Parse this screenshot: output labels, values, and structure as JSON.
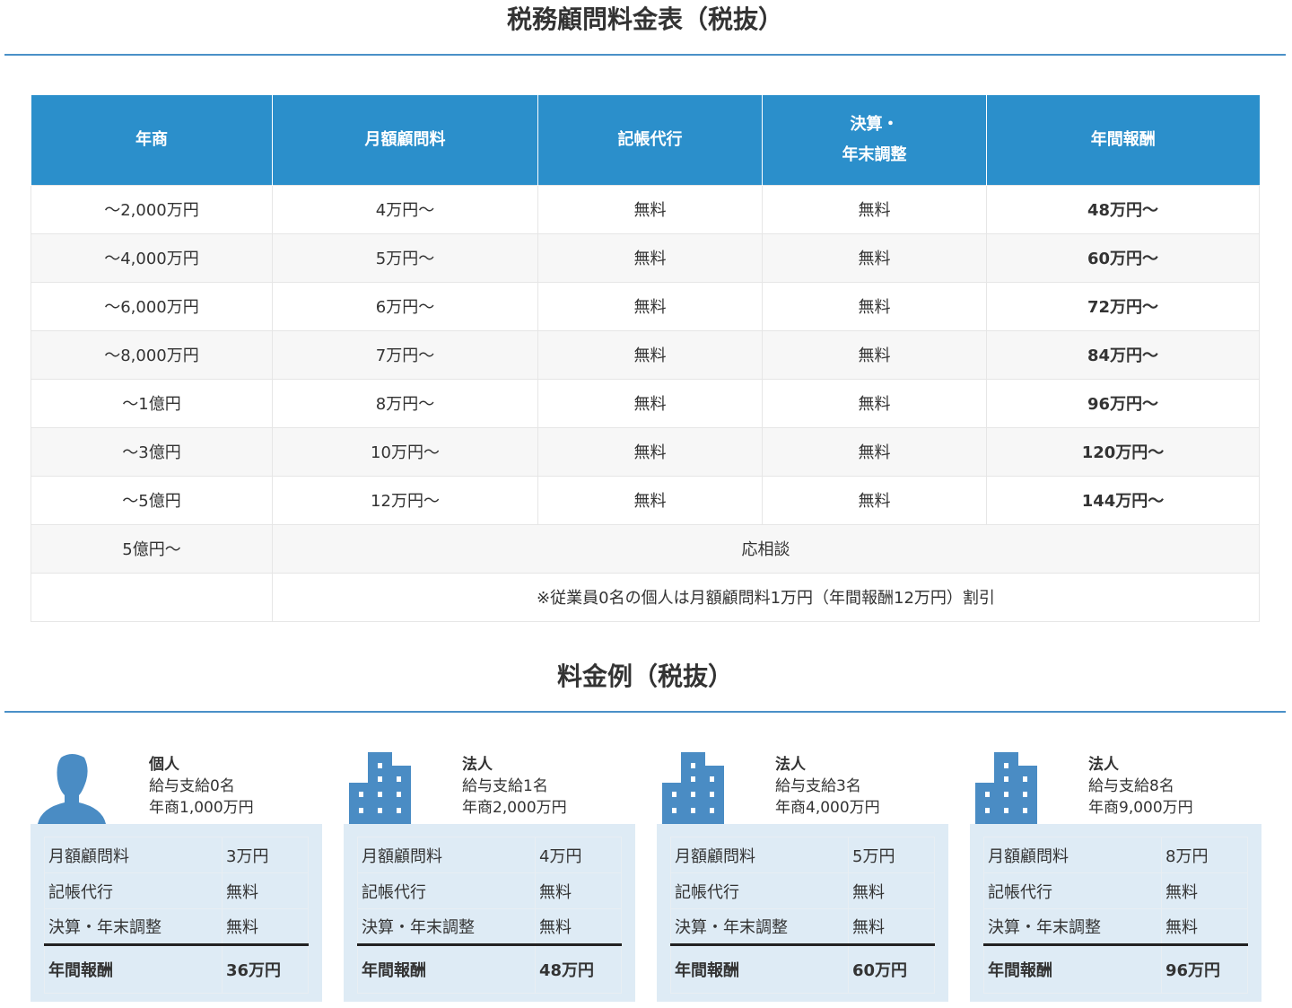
{
  "title": "税務顧問料金表（税抜）",
  "table": {
    "headers": [
      "年商",
      "月額顧問料",
      "記帳代行",
      "決算・",
      "年末調整",
      "年間報酬"
    ],
    "rows": [
      [
        "～2,000万円",
        "4万円～",
        "無料",
        "無料",
        "48万円～"
      ],
      [
        "～4,000万円",
        "5万円～",
        "無料",
        "無料",
        "60万円～"
      ],
      [
        "～6,000万円",
        "6万円～",
        "無料",
        "無料",
        "72万円～"
      ],
      [
        "～8,000万円",
        "7万円～",
        "無料",
        "無料",
        "84万円～"
      ],
      [
        "～1億円",
        "8万円～",
        "無料",
        "無料",
        "96万円～"
      ],
      [
        "～3億円",
        "10万円～",
        "無料",
        "無料",
        "120万円～"
      ],
      [
        "～5億円",
        "12万円～",
        "無料",
        "無料",
        "144万円～"
      ]
    ],
    "over_label": "5億円～",
    "over_value": "応相談",
    "note": "※従業員0名の個人は月額顧問料1万円（年間報酬12万円）割引"
  },
  "examples_title": "料金例（税抜）",
  "examples": [
    {
      "type": "個人",
      "icon": "person-icon",
      "staff": "給与支給0名",
      "sales": "年商1,000万円",
      "monthly": "3万円",
      "bookkeeping": "無料",
      "settlement": "無料",
      "annual": "36万円"
    },
    {
      "type": "法人",
      "icon": "building-icon",
      "staff": "給与支給1名",
      "sales": "年商2,000万円",
      "monthly": "4万円",
      "bookkeeping": "無料",
      "settlement": "無料",
      "annual": "48万円"
    },
    {
      "type": "法人",
      "icon": "building-icon",
      "staff": "給与支給3名",
      "sales": "年商4,000万円",
      "monthly": "5万円",
      "bookkeeping": "無料",
      "settlement": "無料",
      "annual": "60万円"
    },
    {
      "type": "法人",
      "icon": "building-icon",
      "staff": "給与支給8名",
      "sales": "年商9,000万円",
      "monthly": "8万円",
      "bookkeeping": "無料",
      "settlement": "無料",
      "annual": "96万円"
    }
  ],
  "labels": {
    "monthly": "月額顧問料",
    "bookkeeping": "記帳代行",
    "settlement": "決算・年末調整",
    "annual": "年間報酬"
  }
}
